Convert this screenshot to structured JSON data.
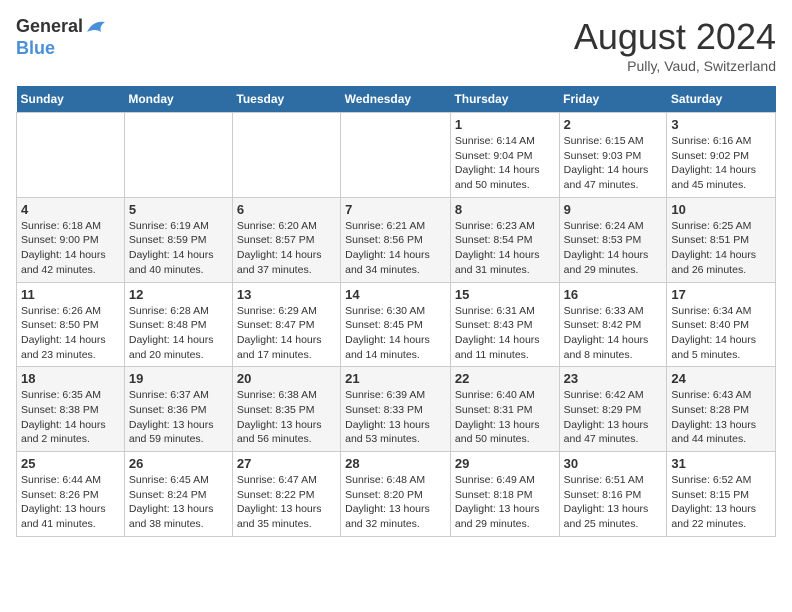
{
  "header": {
    "logo_line1": "General",
    "logo_line2": "Blue",
    "title": "August 2024",
    "subtitle": "Pully, Vaud, Switzerland"
  },
  "weekdays": [
    "Sunday",
    "Monday",
    "Tuesday",
    "Wednesday",
    "Thursday",
    "Friday",
    "Saturday"
  ],
  "weeks": [
    [
      {
        "day": "",
        "info": ""
      },
      {
        "day": "",
        "info": ""
      },
      {
        "day": "",
        "info": ""
      },
      {
        "day": "",
        "info": ""
      },
      {
        "day": "1",
        "info": "Sunrise: 6:14 AM\nSunset: 9:04 PM\nDaylight: 14 hours and 50 minutes."
      },
      {
        "day": "2",
        "info": "Sunrise: 6:15 AM\nSunset: 9:03 PM\nDaylight: 14 hours and 47 minutes."
      },
      {
        "day": "3",
        "info": "Sunrise: 6:16 AM\nSunset: 9:02 PM\nDaylight: 14 hours and 45 minutes."
      }
    ],
    [
      {
        "day": "4",
        "info": "Sunrise: 6:18 AM\nSunset: 9:00 PM\nDaylight: 14 hours and 42 minutes."
      },
      {
        "day": "5",
        "info": "Sunrise: 6:19 AM\nSunset: 8:59 PM\nDaylight: 14 hours and 40 minutes."
      },
      {
        "day": "6",
        "info": "Sunrise: 6:20 AM\nSunset: 8:57 PM\nDaylight: 14 hours and 37 minutes."
      },
      {
        "day": "7",
        "info": "Sunrise: 6:21 AM\nSunset: 8:56 PM\nDaylight: 14 hours and 34 minutes."
      },
      {
        "day": "8",
        "info": "Sunrise: 6:23 AM\nSunset: 8:54 PM\nDaylight: 14 hours and 31 minutes."
      },
      {
        "day": "9",
        "info": "Sunrise: 6:24 AM\nSunset: 8:53 PM\nDaylight: 14 hours and 29 minutes."
      },
      {
        "day": "10",
        "info": "Sunrise: 6:25 AM\nSunset: 8:51 PM\nDaylight: 14 hours and 26 minutes."
      }
    ],
    [
      {
        "day": "11",
        "info": "Sunrise: 6:26 AM\nSunset: 8:50 PM\nDaylight: 14 hours and 23 minutes."
      },
      {
        "day": "12",
        "info": "Sunrise: 6:28 AM\nSunset: 8:48 PM\nDaylight: 14 hours and 20 minutes."
      },
      {
        "day": "13",
        "info": "Sunrise: 6:29 AM\nSunset: 8:47 PM\nDaylight: 14 hours and 17 minutes."
      },
      {
        "day": "14",
        "info": "Sunrise: 6:30 AM\nSunset: 8:45 PM\nDaylight: 14 hours and 14 minutes."
      },
      {
        "day": "15",
        "info": "Sunrise: 6:31 AM\nSunset: 8:43 PM\nDaylight: 14 hours and 11 minutes."
      },
      {
        "day": "16",
        "info": "Sunrise: 6:33 AM\nSunset: 8:42 PM\nDaylight: 14 hours and 8 minutes."
      },
      {
        "day": "17",
        "info": "Sunrise: 6:34 AM\nSunset: 8:40 PM\nDaylight: 14 hours and 5 minutes."
      }
    ],
    [
      {
        "day": "18",
        "info": "Sunrise: 6:35 AM\nSunset: 8:38 PM\nDaylight: 14 hours and 2 minutes."
      },
      {
        "day": "19",
        "info": "Sunrise: 6:37 AM\nSunset: 8:36 PM\nDaylight: 13 hours and 59 minutes."
      },
      {
        "day": "20",
        "info": "Sunrise: 6:38 AM\nSunset: 8:35 PM\nDaylight: 13 hours and 56 minutes."
      },
      {
        "day": "21",
        "info": "Sunrise: 6:39 AM\nSunset: 8:33 PM\nDaylight: 13 hours and 53 minutes."
      },
      {
        "day": "22",
        "info": "Sunrise: 6:40 AM\nSunset: 8:31 PM\nDaylight: 13 hours and 50 minutes."
      },
      {
        "day": "23",
        "info": "Sunrise: 6:42 AM\nSunset: 8:29 PM\nDaylight: 13 hours and 47 minutes."
      },
      {
        "day": "24",
        "info": "Sunrise: 6:43 AM\nSunset: 8:28 PM\nDaylight: 13 hours and 44 minutes."
      }
    ],
    [
      {
        "day": "25",
        "info": "Sunrise: 6:44 AM\nSunset: 8:26 PM\nDaylight: 13 hours and 41 minutes."
      },
      {
        "day": "26",
        "info": "Sunrise: 6:45 AM\nSunset: 8:24 PM\nDaylight: 13 hours and 38 minutes."
      },
      {
        "day": "27",
        "info": "Sunrise: 6:47 AM\nSunset: 8:22 PM\nDaylight: 13 hours and 35 minutes."
      },
      {
        "day": "28",
        "info": "Sunrise: 6:48 AM\nSunset: 8:20 PM\nDaylight: 13 hours and 32 minutes."
      },
      {
        "day": "29",
        "info": "Sunrise: 6:49 AM\nSunset: 8:18 PM\nDaylight: 13 hours and 29 minutes."
      },
      {
        "day": "30",
        "info": "Sunrise: 6:51 AM\nSunset: 8:16 PM\nDaylight: 13 hours and 25 minutes."
      },
      {
        "day": "31",
        "info": "Sunrise: 6:52 AM\nSunset: 8:15 PM\nDaylight: 13 hours and 22 minutes."
      }
    ]
  ]
}
